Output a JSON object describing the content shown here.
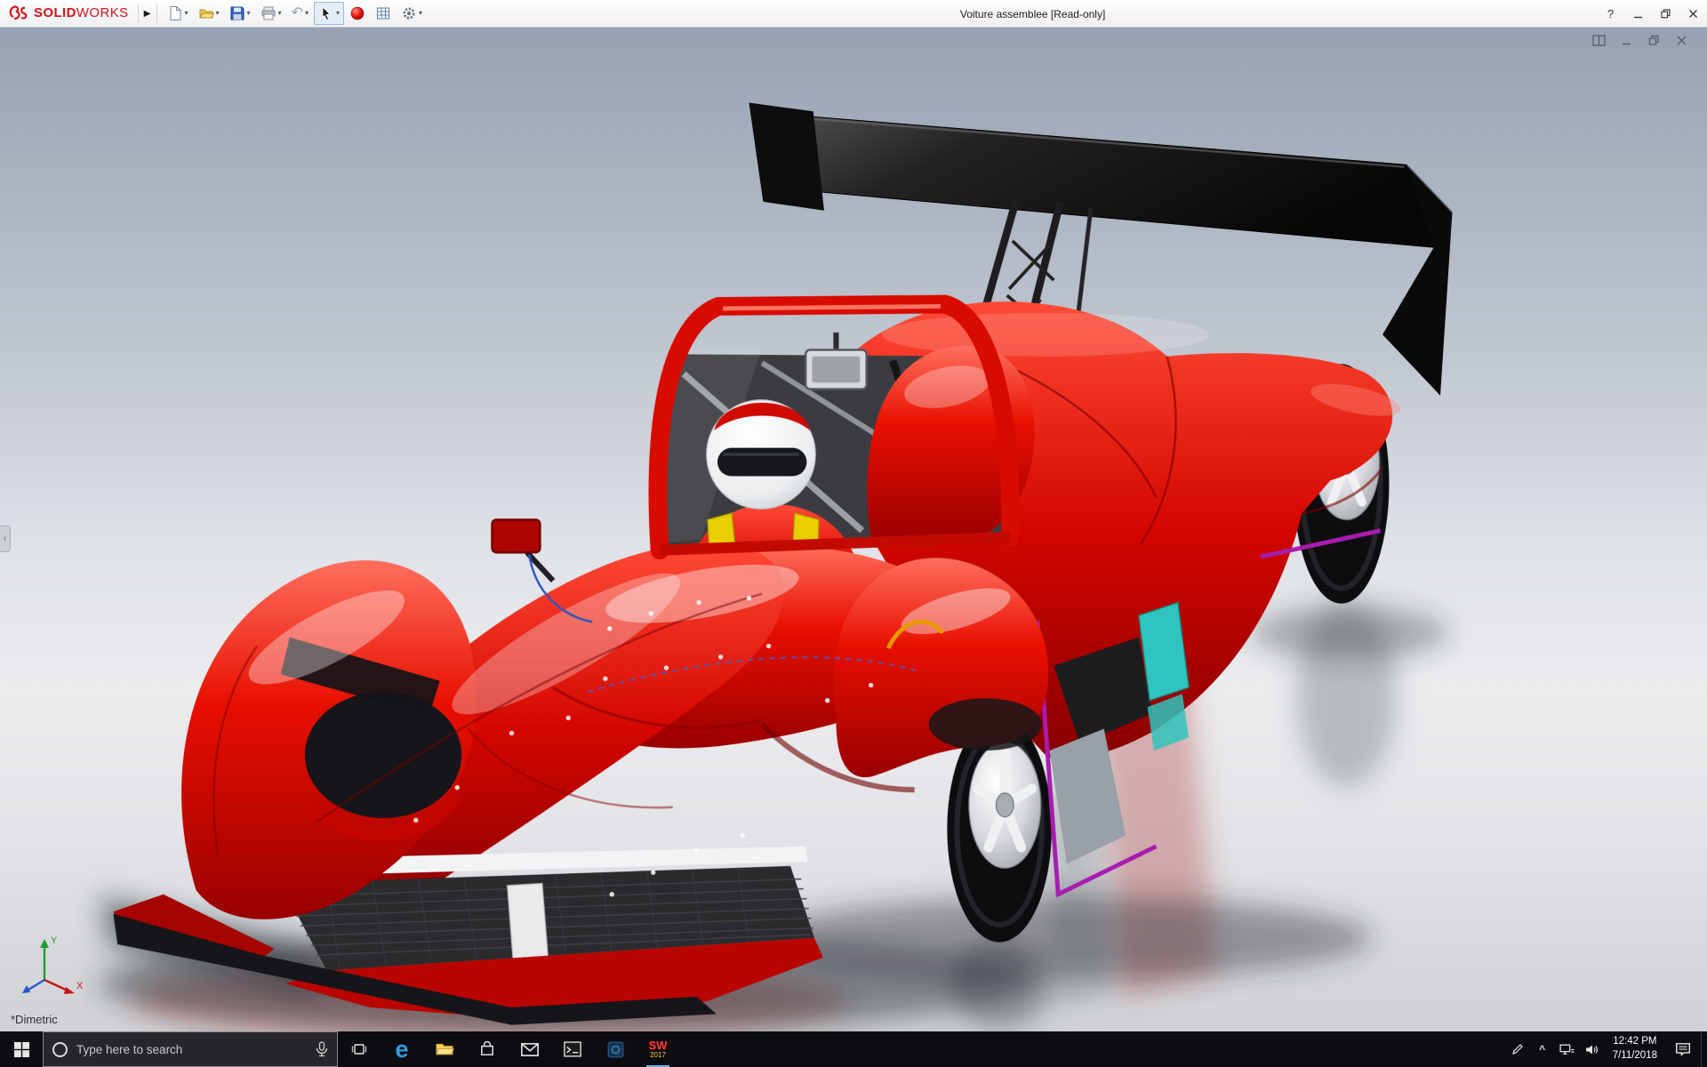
{
  "app": {
    "brand_bold": "SOLID",
    "brand_light": "WORKS",
    "title": "Voiture assemblee [Read-only]"
  },
  "titlebar": {
    "flyout_arrow": "▶",
    "caret_glyph": "▾",
    "undo_glyph": "↶",
    "help_glyph": "?",
    "toolbar_icons": [
      "new-document",
      "open",
      "save",
      "print",
      "undo",
      "select",
      "appearance-sphere",
      "design-table",
      "options-gear"
    ]
  },
  "viewport": {
    "view_orientation": "*Dimetric",
    "flyout_glyph": "‹",
    "doc_window_icons": [
      "tile-window",
      "minimize-window",
      "restore-window",
      "close-window"
    ],
    "triad": {
      "x_label": "X",
      "y_label": "Y"
    },
    "model": {
      "description": "red prototype race car with driver and black rear wing",
      "body_color": "#d80b00",
      "wing_color": "#101010",
      "accent_teal": "#2fc4bd",
      "accent_magenta": "#a81cb0",
      "rim_color": "#d9dbde"
    }
  },
  "taskbar": {
    "search_placeholder": "Type here to search",
    "edge_glyph": "e",
    "solidworks_label": "SW",
    "solidworks_year": "2017",
    "tray_chevron": "^",
    "clock_time": "12:42 PM",
    "clock_date": "7/11/2018",
    "app_icons": [
      "start",
      "cortana-search",
      "task-view",
      "edge",
      "file-explorer",
      "store",
      "mail",
      "terminal",
      "dark-blue-app",
      "solidworks-2017"
    ]
  }
}
